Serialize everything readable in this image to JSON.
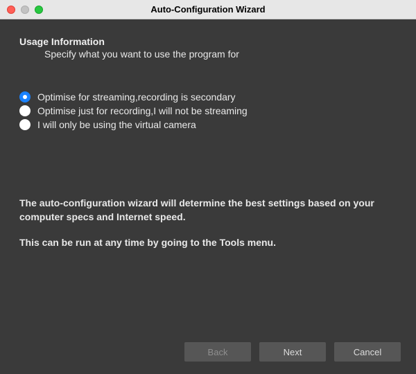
{
  "window": {
    "title": "Auto-Configuration Wizard"
  },
  "header": {
    "title": "Usage Information",
    "subtitle": "Specify what you want to use the program for"
  },
  "radios": {
    "selected_index": 0,
    "options": [
      {
        "label": "Optimise for streaming,recording is secondary"
      },
      {
        "label": "Optimise just for recording,I will not be streaming"
      },
      {
        "label": "I will only be using the virtual camera"
      }
    ]
  },
  "info": {
    "p1": "The auto-configuration wizard will determine the best settings based on your computer specs and Internet speed.",
    "p2": "This can be run at any time by going to the Tools menu."
  },
  "buttons": {
    "back": "Back",
    "next": "Next",
    "cancel": "Cancel",
    "back_disabled": true
  }
}
